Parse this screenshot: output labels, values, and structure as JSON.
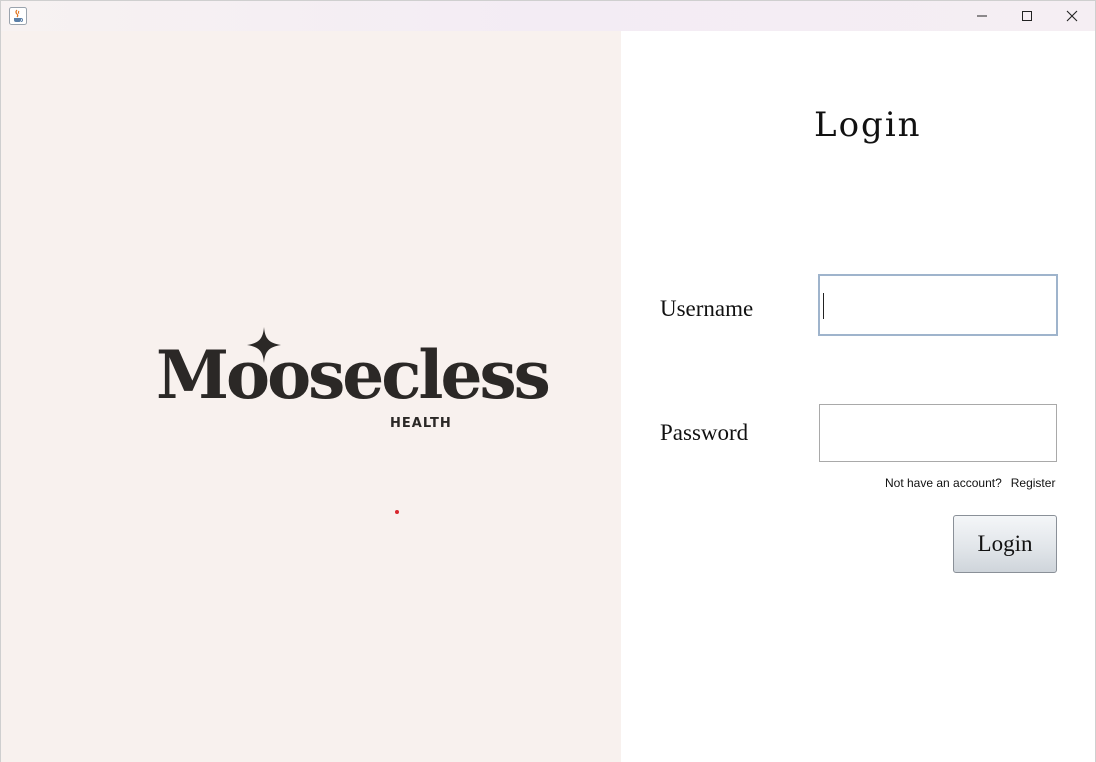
{
  "window": {
    "icon": "java-cup-icon",
    "controls": {
      "minimize": "minimize-icon",
      "maximize": "maximize-icon",
      "close": "close-icon"
    }
  },
  "brand": {
    "name": "Moosecless",
    "tagline": "HEALTH",
    "text_color": "#2b2826",
    "background": "#f8f1ee"
  },
  "login": {
    "title": "Login",
    "username_label": "Username",
    "username_value": "",
    "password_label": "Password",
    "password_value": "",
    "no_account_text": "Not have an account?",
    "register_link": "Register",
    "login_button": "Login"
  }
}
